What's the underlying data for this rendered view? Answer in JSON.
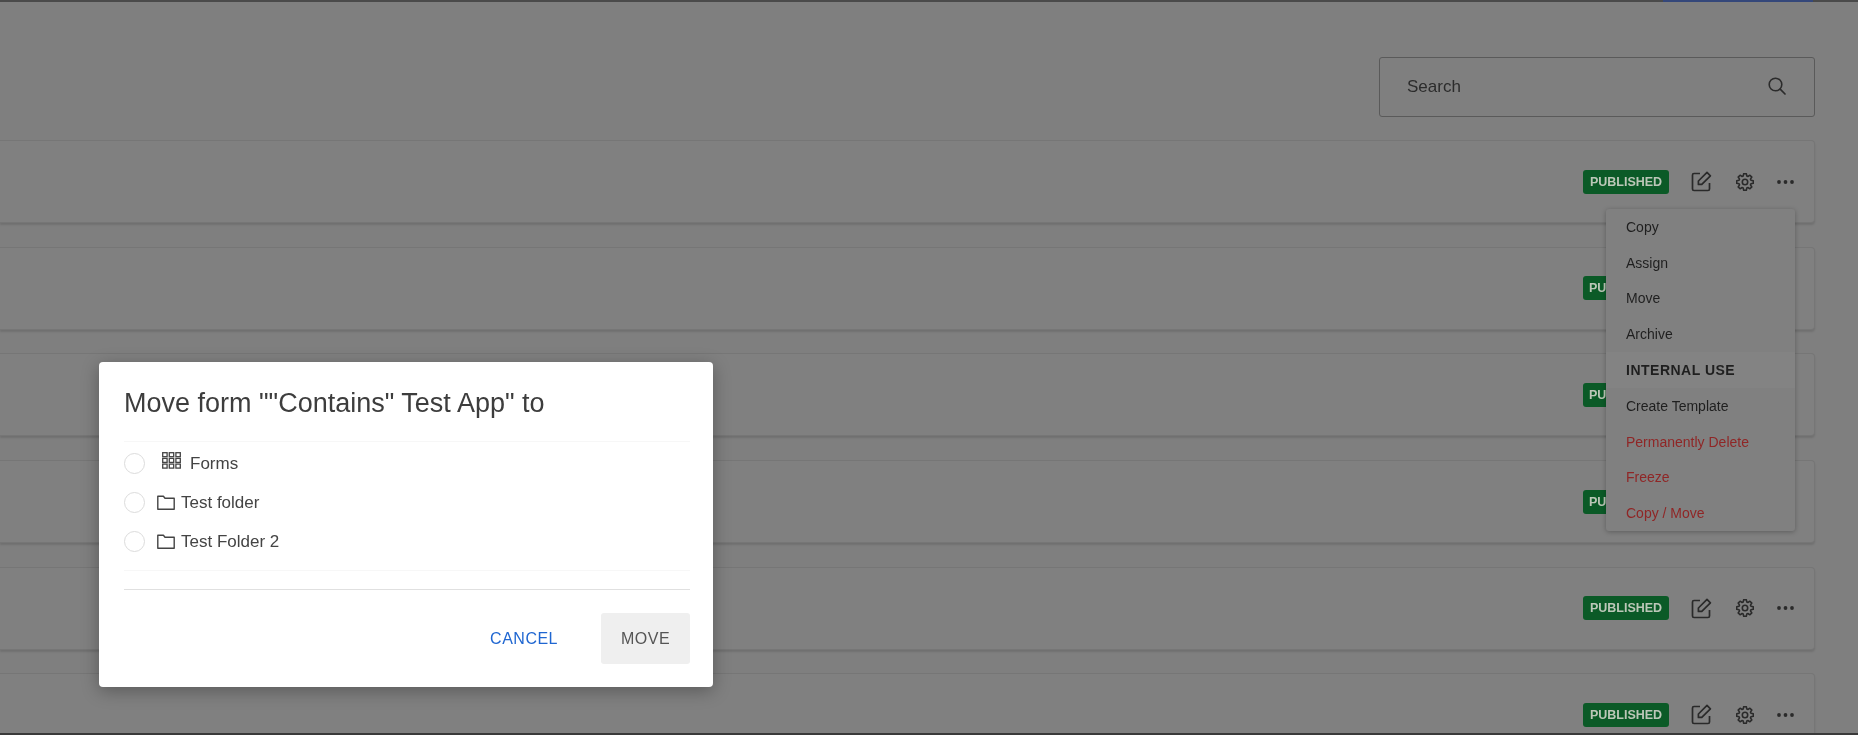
{
  "search": {
    "placeholder": "Search"
  },
  "rows": [
    {
      "status": "PUBLISHED",
      "actions_visible": true,
      "menu": {
        "items": [
          {
            "label": "Copy",
            "kind": "item"
          },
          {
            "label": "Assign",
            "kind": "item"
          },
          {
            "label": "Move",
            "kind": "item"
          },
          {
            "label": "Archive",
            "kind": "item"
          },
          {
            "label": "INTERNAL USE",
            "kind": "header"
          },
          {
            "label": "Create Template",
            "kind": "item"
          },
          {
            "label": "Permanently Delete",
            "kind": "danger"
          },
          {
            "label": "Freeze",
            "kind": "danger"
          },
          {
            "label": "Copy / Move",
            "kind": "danger"
          }
        ]
      }
    },
    {
      "status": "PU",
      "actions_visible": false
    },
    {
      "status": "PU",
      "actions_visible": false
    },
    {
      "status": "PU",
      "actions_visible": false
    },
    {
      "status": "PUBLISHED",
      "actions_visible": true
    },
    {
      "status": "PUBLISHED",
      "actions_visible": true
    }
  ],
  "dialog": {
    "title": "Move form \"\"Contains\" Test App\" to",
    "options": [
      {
        "label": "Forms",
        "kind": "root",
        "selected": false
      },
      {
        "label": "Test folder",
        "kind": "folder",
        "selected": false
      },
      {
        "label": "Test Folder 2",
        "kind": "folder",
        "selected": false
      }
    ],
    "buttons": [
      {
        "label": "CANCEL",
        "kind": "text",
        "disabled": false
      },
      {
        "label": "MOVE",
        "kind": "filled",
        "disabled": true
      }
    ]
  }
}
